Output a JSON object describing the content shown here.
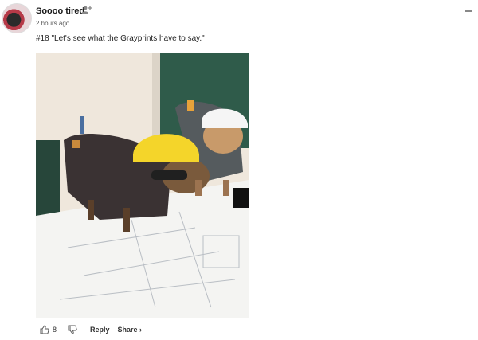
{
  "comment": {
    "username": "Soooo tired",
    "timestamp": "2 hours ago",
    "text": "#18 \"Let's see what the Grayprints have to say.\""
  },
  "actions": {
    "upvote_count": "8",
    "reply_label": "Reply",
    "share_label": "Share ›"
  },
  "icons": {
    "follow": "add-user-icon",
    "collapse": "minus-icon",
    "upvote": "thumbs-up-icon",
    "downvote": "thumbs-down-icon"
  }
}
